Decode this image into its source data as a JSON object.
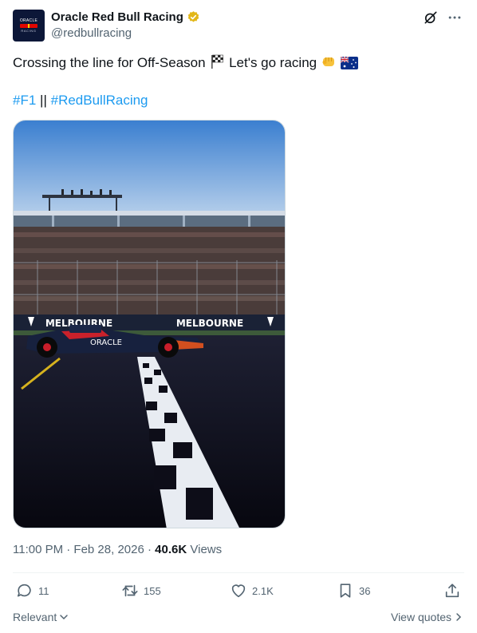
{
  "author": {
    "display_name": "Oracle Red Bull Racing",
    "handle": "@redbullracing",
    "avatar_text_top": "ORACLE",
    "avatar_text_bottom": "RACING",
    "verified_badge_color": "#e2b719"
  },
  "tweet": {
    "text": "Crossing the line for Off-Season",
    "text_after_flag": "Let's go racing",
    "emojis": [
      "chequered-flag",
      "fist",
      "australia-flag"
    ],
    "hashtags": [
      "#F1",
      "#RedBullRacing"
    ],
    "hashtag_separator": "||"
  },
  "media": {
    "banner_text_left": "MELBOURNE",
    "banner_text_right": "MELBOURNE",
    "car_sponsor": "ORACLE"
  },
  "meta": {
    "timestamp": "11:00 PM · Feb 28, 2026 ·",
    "views_count": "40.6K",
    "views_label": "Views"
  },
  "actions": {
    "replies": "11",
    "reposts": "155",
    "likes": "2.1K",
    "bookmarks": "36"
  },
  "footer": {
    "sort_label": "Relevant",
    "view_quotes_label": "View quotes"
  },
  "colors": {
    "link": "#1d9bf0",
    "secondary_text": "#536471",
    "primary_text": "#0f1419"
  }
}
